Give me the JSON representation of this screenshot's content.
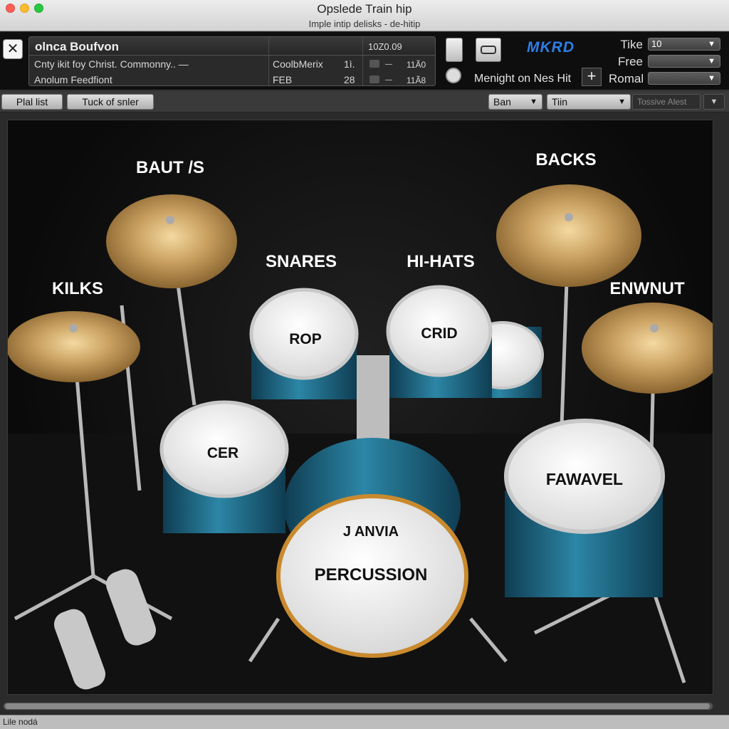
{
  "window": {
    "title": "Opslede Train hip",
    "subtitle": "Imple intip delisks - de-hitip"
  },
  "track": {
    "title": "olnca Boufvon",
    "time": "10Z0.09",
    "rows": [
      {
        "name": "Cnty ikit foy Christ. Commonny.. —",
        "genre": "CoolbMerix",
        "num": "1ì.",
        "dur": "11Ã0"
      },
      {
        "name": "Anolum Feedfiont",
        "genre": "FEB",
        "num": "28",
        "dur": "11Ã8"
      }
    ]
  },
  "toolbar": {
    "close_label": "✕",
    "brand": "MKRD",
    "midnight_label": "Menight on Nes Hit",
    "plus_label": "+",
    "controls": [
      {
        "label": "Tike",
        "value": "10"
      },
      {
        "label": "Free",
        "value": ""
      },
      {
        "label": "Romal",
        "value": ""
      }
    ]
  },
  "subbar": {
    "tab1": "Plal list",
    "tab2": "Tuck of snler",
    "drop1": "Ban",
    "drop2": "Tiin",
    "drop3": "Tossive Alest"
  },
  "kit": {
    "labels": {
      "baut": "BAUT /S",
      "backs": "BACKS",
      "snares": "SNARES",
      "hihats": "HI-HATS",
      "kilks": "KILKS",
      "enwnut": "ENWNUT"
    },
    "drums": {
      "rop": "ROP",
      "crid": "CRID",
      "cer": "CER",
      "fawavel": "FAWAVEL",
      "janvia": "J ANVIA",
      "percussion": "PERCUSSION"
    },
    "colors": {
      "shell": "#1f6b86",
      "cymbal": "#c9a061",
      "head": "#f2f2f2",
      "hoop": "#c8c8c8",
      "kick_hoop": "#c98a2e"
    }
  },
  "status": {
    "text": "Lile nodá"
  }
}
